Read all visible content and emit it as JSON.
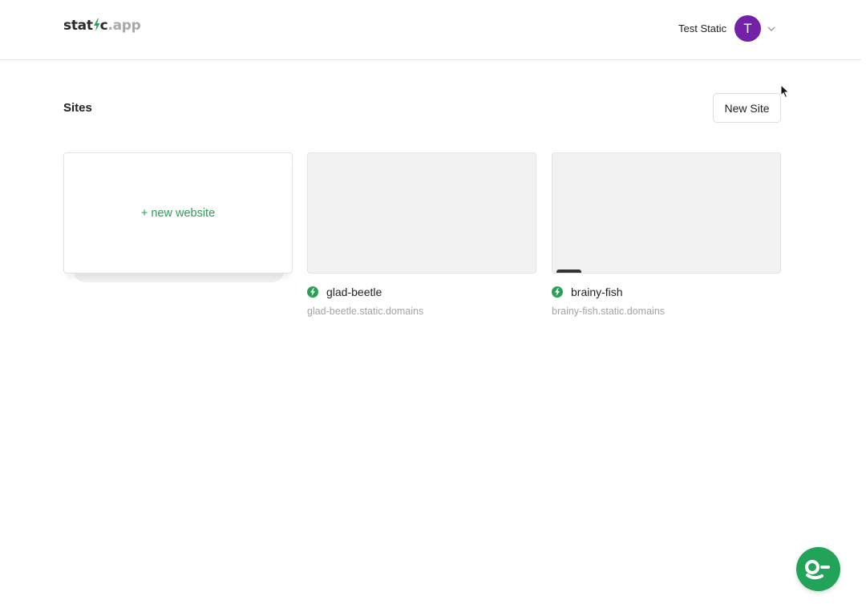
{
  "header": {
    "logo": {
      "part1": "stat",
      "part2": "c",
      "part3": ".app"
    },
    "user": {
      "name": "Test Static",
      "avatar_initial": "T",
      "avatar_color": "#7321a6"
    }
  },
  "main": {
    "title": "Sites",
    "new_site_label": "New Site",
    "new_card_label": "+ new website",
    "sites": [
      {
        "name": "glad-beetle",
        "domain": "glad-beetle.static.domains",
        "status_icon": "bolt-icon",
        "status_color": "#2aa155"
      },
      {
        "name": "brainy-fish",
        "domain": "brainy-fish.static.domains",
        "status_icon": "bolt-icon",
        "status_color": "#2aa155"
      }
    ]
  },
  "colors": {
    "accent": "#2e9b55",
    "chat_button": "#22a35a"
  },
  "chat": {
    "icon": "chat-support-icon"
  }
}
